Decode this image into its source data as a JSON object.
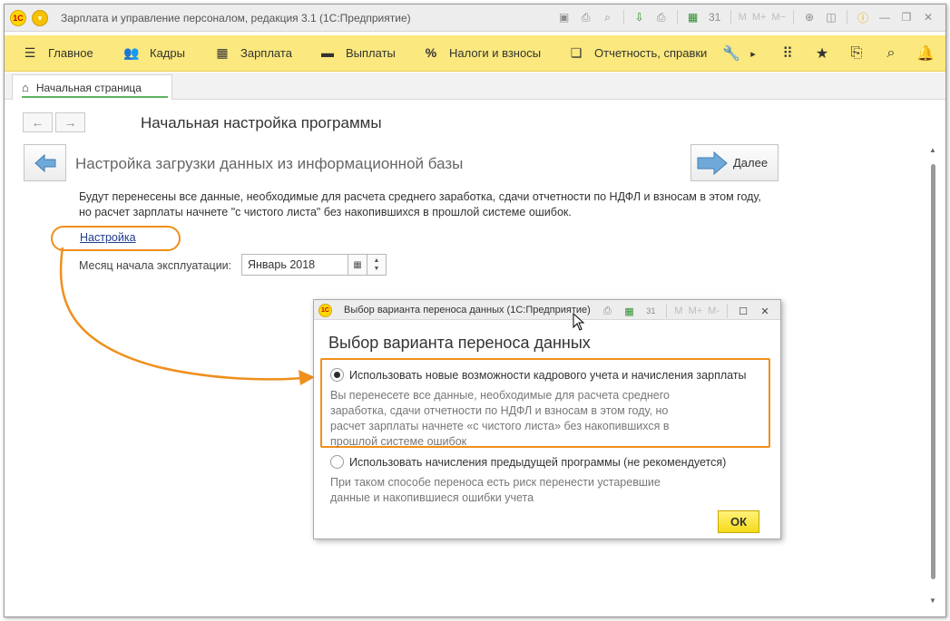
{
  "window": {
    "title": "Зарплата и управление персоналом, редакция 3.1  (1С:Предприятие)",
    "logo_text": "1С"
  },
  "titlebar_icons": [
    "save-icon",
    "print-icon",
    "print-preview-icon",
    "download-icon",
    "printer-icon",
    "calculator-icon",
    "calendar-icon",
    "M",
    "M+",
    "M-",
    "zoom-icon",
    "window-icon",
    "info-icon",
    "minimize-icon",
    "restore-icon",
    "close-icon"
  ],
  "menu": {
    "items": [
      {
        "label": "Главное",
        "icon": "hamburger-icon"
      },
      {
        "label": "Кадры",
        "icon": "people-icon"
      },
      {
        "label": "Зарплата",
        "icon": "calculator-icon"
      },
      {
        "label": "Выплаты",
        "icon": "wallet-icon"
      },
      {
        "label": "Налоги и взносы",
        "icon": "percent-icon"
      },
      {
        "label": "Отчетность, справки",
        "icon": "report-icon"
      }
    ],
    "right_icons": [
      "wrench-icon",
      "more-icon",
      "apps-grid-icon",
      "star-icon",
      "history-icon",
      "search-icon",
      "bell-icon"
    ]
  },
  "tabs": {
    "home_label": "Начальная страница"
  },
  "page": {
    "title": "Начальная настройка программы",
    "section_title": "Настройка загрузки данных из информационной базы",
    "next_label": "Далее",
    "description": "Будут перенесены все данные, необходимые для расчета среднего заработка, сдачи отчетности по НДФЛ и взносам в этом году, но расчет зарплаты начнете \"с чистого листа\" без накопившихся в прошлой системе ошибок.",
    "setup_link": "Настройка",
    "month_label": "Месяц начала эксплуатации:",
    "month_value": "Январь 2018"
  },
  "dialog": {
    "title": "Выбор варианта переноса данных  (1С:Предприятие)",
    "heading": "Выбор варианта переноса данных",
    "toolbar": [
      "M",
      "M+",
      "M-"
    ],
    "option1": {
      "label": "Использовать новые возможности кадрового учета и начисления зарплаты",
      "selected": true,
      "desc_lines": [
        "Вы перенесете все данные, необходимые для расчета среднего",
        "заработка, сдачи отчетности по НДФЛ и взносам в этом году, но",
        "расчет зарплаты начнете «с чистого листа» без накопившихся в",
        "прошлой системе ошибок"
      ]
    },
    "option2": {
      "label": "Использовать начисления предыдущей программы (не рекомендуется)",
      "selected": false,
      "desc_lines": [
        "При таком способе переноса есть риск перенести устаревшие",
        "данные и накопившиеся ошибки учета"
      ]
    },
    "ok_label": "ОК"
  },
  "colors": {
    "menubar": "#fbe87e",
    "highlight": "#ef8f1c",
    "ok_button": "#f6da1a",
    "link": "#1c3c8c"
  }
}
